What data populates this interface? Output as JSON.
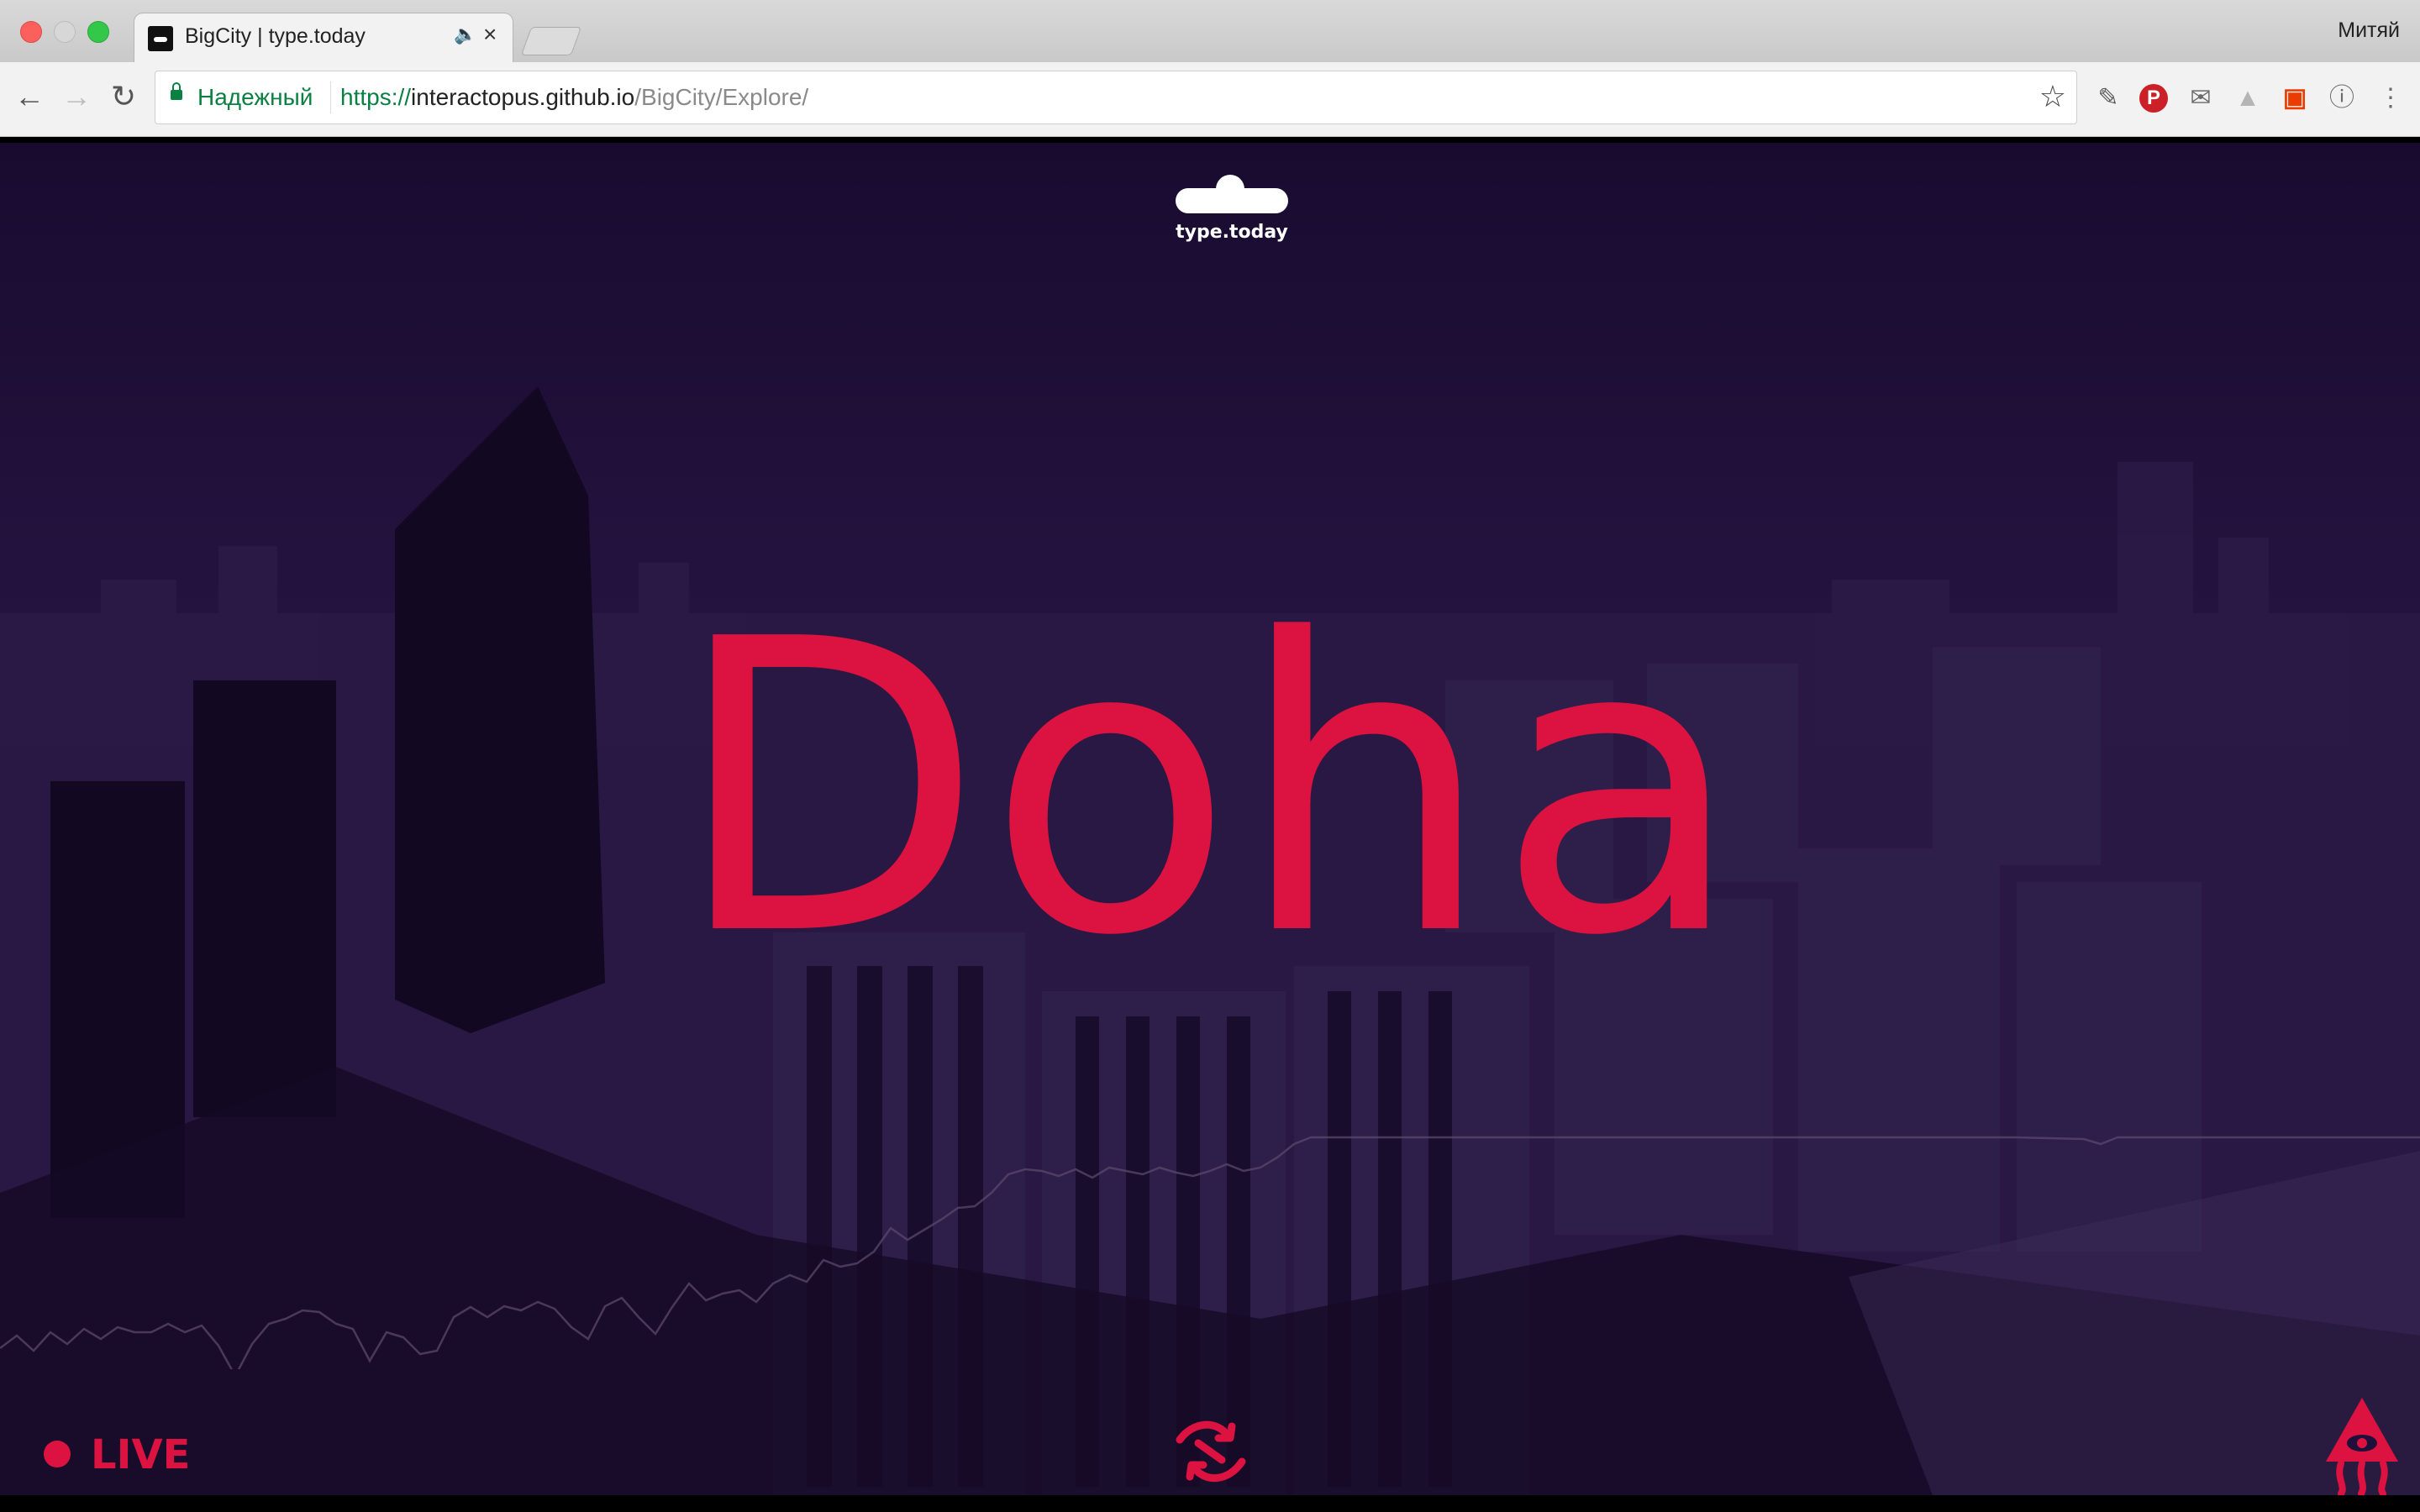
{
  "browser": {
    "tab_title": "BigCity | type.today",
    "tab_close": "×",
    "profile_name": "Митяй",
    "secure_label": "Надежный",
    "url_scheme": "https://",
    "url_host": "interactopus.github.io",
    "url_path": "/BigCity/Explore/"
  },
  "page": {
    "brand": "type.today",
    "city": "Doha",
    "live_label": "LIVE"
  },
  "colors": {
    "accent": "#dc1240",
    "background": "#1f0f3b",
    "secure": "#0b8043"
  },
  "icons": {
    "shuffle": "shuffle-icon",
    "interactopus": "octopus-logo-icon"
  }
}
